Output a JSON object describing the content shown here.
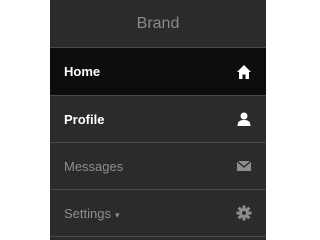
{
  "brand": "Brand",
  "nav": [
    {
      "label": "Home",
      "icon": "home-icon",
      "active": true
    },
    {
      "label": "Profile",
      "icon": "user-icon",
      "active": false
    },
    {
      "label": "Messages",
      "icon": "envelope-icon",
      "active": false
    },
    {
      "label": "Settings",
      "icon": "gear-icon",
      "active": false,
      "caret": "▾"
    }
  ],
  "colors": {
    "sidebar_bg": "#2b2b2b",
    "active_bg": "#0d0d0d",
    "text_bright": "#ffffff",
    "text_dim": "#8e8e8e"
  }
}
